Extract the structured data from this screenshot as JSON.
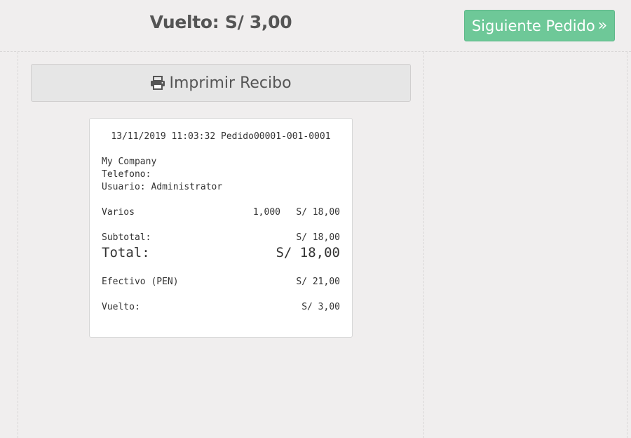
{
  "header": {
    "change_title": "Vuelto: S/ 3,00",
    "next_button_label": "Siguiente Pedido",
    "next_button_icon": "double-chevron-right-icon",
    "next_button_color": "#6ec898"
  },
  "print_button": {
    "label": "Imprimir Recibo",
    "icon": "printer-icon"
  },
  "receipt": {
    "header_line": "13/11/2019 11:03:32 Pedido00001-001-0001",
    "company": "My Company",
    "phone_label": "Telefono:",
    "user_line": "Usuario: Administrator",
    "items": [
      {
        "name": "Varios",
        "qty": "1,000",
        "price": "S/ 18,00"
      }
    ],
    "subtotal_label": "Subtotal:",
    "subtotal_value": "S/ 18,00",
    "total_label": "Total:",
    "total_value": "S/ 18,00",
    "payment_label": "Efectivo (PEN)",
    "payment_value": "S/ 21,00",
    "change_label": "Vuelto:",
    "change_value": "S/ 3,00"
  }
}
